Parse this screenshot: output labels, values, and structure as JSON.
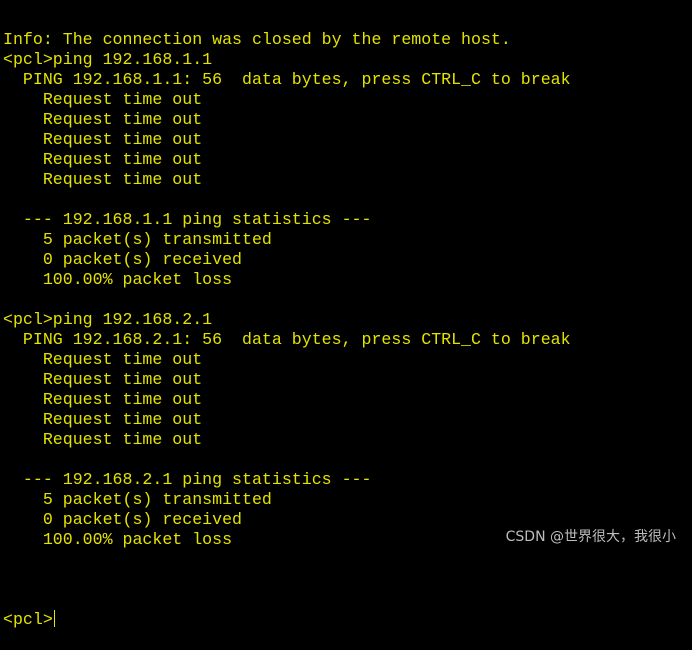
{
  "terminal": {
    "lines": [
      "Info: The connection was closed by the remote host.",
      "<pcl>ping 192.168.1.1",
      "  PING 192.168.1.1: 56  data bytes, press CTRL_C to break",
      "    Request time out",
      "    Request time out",
      "    Request time out",
      "    Request time out",
      "    Request time out",
      "",
      "  --- 192.168.1.1 ping statistics ---",
      "    5 packet(s) transmitted",
      "    0 packet(s) received",
      "    100.00% packet loss",
      "",
      "<pcl>ping 192.168.2.1",
      "  PING 192.168.2.1: 56  data bytes, press CTRL_C to break",
      "    Request time out",
      "    Request time out",
      "    Request time out",
      "    Request time out",
      "    Request time out",
      "",
      "  --- 192.168.2.1 ping statistics ---",
      "    5 packet(s) transmitted",
      "    0 packet(s) received",
      "    100.00% packet loss",
      ""
    ],
    "prompt": "<pcl>",
    "text_color": "#e3e300",
    "background": "#000000"
  },
  "watermark": "CSDN @世界很大，我很小"
}
